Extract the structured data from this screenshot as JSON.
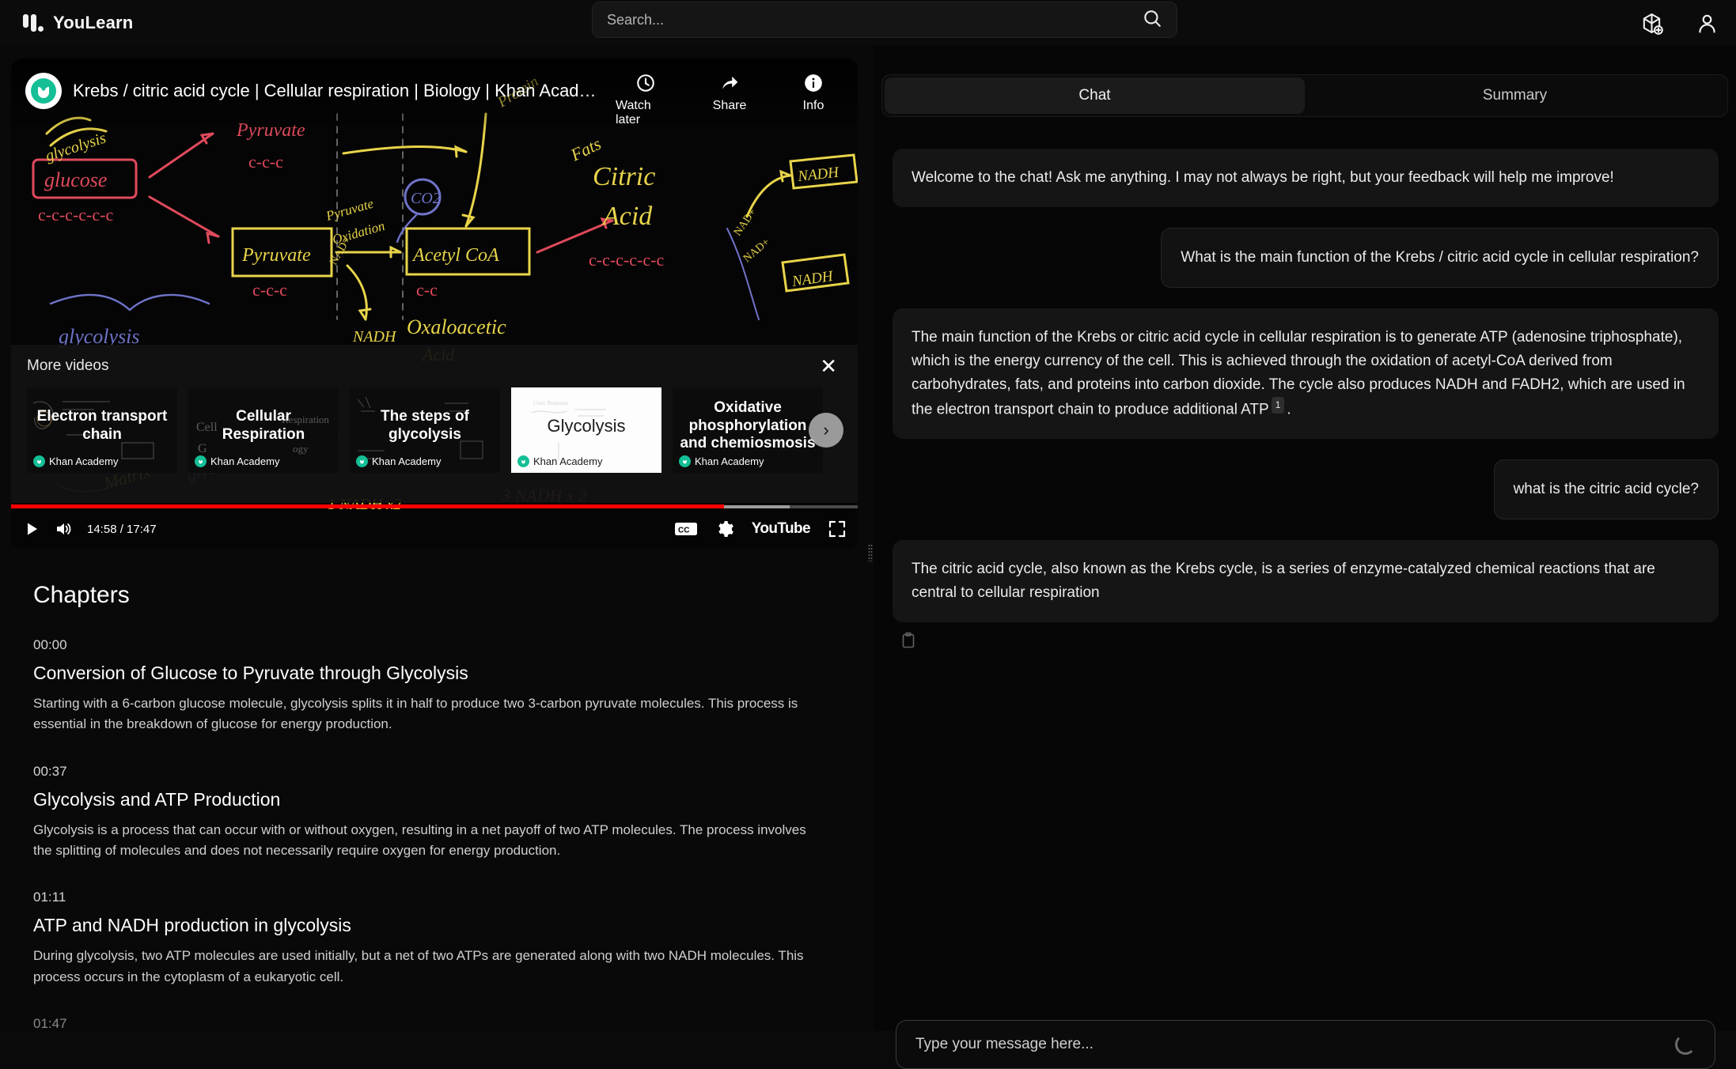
{
  "app": {
    "brand": "YouLearn",
    "logo_icon": "youlearn-logo-icon"
  },
  "header": {
    "search_placeholder": "Search...",
    "search_value": "",
    "search_icon": "search-icon",
    "add_content_icon": "cube-plus-icon",
    "profile_icon": "user-avatar-icon"
  },
  "video": {
    "title": "Krebs / citric acid cycle | Cellular respiration | Biology | Khan Acade...",
    "channel_avatar_icon": "khan-academy-logo-icon",
    "top_actions": [
      {
        "label": "Watch later",
        "icon": "clock-icon"
      },
      {
        "label": "Share",
        "icon": "share-arrow-icon"
      },
      {
        "label": "Info",
        "icon": "info-circle-icon"
      }
    ],
    "current_time": "14:58",
    "duration": "17:47",
    "time_display": "14:58 / 17:47",
    "progress_percent": 84.2,
    "buffered_percent": 92,
    "play_icon": "play-icon",
    "volume_icon": "volume-icon",
    "captions_icon": "closed-captions-icon",
    "settings_icon": "gear-icon",
    "youtube_logo": "YouTube",
    "fullscreen_icon": "fullscreen-icon",
    "progress_color": "#ff0000"
  },
  "more_videos": {
    "title": "More videos",
    "close_icon": "close-icon",
    "next_icon": "chevron-right-icon",
    "cards": [
      {
        "title": "Electron transport chain",
        "channel": "Khan Academy",
        "theme": "dark"
      },
      {
        "title": "Cellular Respiration",
        "channel": "Khan Academy",
        "theme": "dark"
      },
      {
        "title": "The steps of glycolysis",
        "channel": "Khan Academy",
        "theme": "dark"
      },
      {
        "title": "Glycolysis",
        "channel": "Khan Academy",
        "theme": "light"
      },
      {
        "title": "Oxidative phosphorylation and chemiosmosis",
        "channel": "Khan Academy",
        "theme": "dark"
      }
    ]
  },
  "chapters": {
    "heading": "Chapters",
    "items": [
      {
        "time": "00:00",
        "name": "Conversion of Glucose to Pyruvate through Glycolysis",
        "desc": "Starting with a 6-carbon glucose molecule, glycolysis splits it in half to produce two 3-carbon pyruvate molecules. This process is essential in the breakdown of glucose for energy production."
      },
      {
        "time": "00:37",
        "name": "Glycolysis and ATP Production",
        "desc": "Glycolysis is a process that can occur with or without oxygen, resulting in a net payoff of two ATP molecules. The process involves the splitting of molecules and does not necessarily require oxygen for energy production."
      },
      {
        "time": "01:11",
        "name": "ATP and NADH production in glycolysis",
        "desc": "During glycolysis, two ATP molecules are used initially, but a net of two ATPs are generated along with two NADH molecules. This process occurs in the cytoplasm of a eukaryotic cell."
      }
    ],
    "next_time": "01:47"
  },
  "chat": {
    "tabs": [
      {
        "label": "Chat",
        "active": true
      },
      {
        "label": "Summary",
        "active": false
      }
    ],
    "messages": [
      {
        "role": "bot",
        "text": "Welcome to the chat! Ask me anything. I may not always be right, but your feedback will help me improve!"
      },
      {
        "role": "user",
        "text": "What is the main function of the Krebs / citric acid cycle in cellular respiration?"
      },
      {
        "role": "bot",
        "text_before_citation": "The main function of the Krebs or citric acid cycle in cellular respiration is to generate ATP (adenosine triphosphate), which is the energy currency of the cell. This is achieved through the oxidation of acetyl-CoA derived from carbohydrates, fats, and proteins into carbon dioxide. The cycle also produces NADH and FADH2, which are used in the electron transport chain to produce additional ATP",
        "citation": "1",
        "text_after_citation": "."
      },
      {
        "role": "user",
        "text": "what is the citric acid cycle?"
      },
      {
        "role": "bot",
        "text": "The citric acid cycle, also known as the Krebs cycle, is a series of enzyme-catalyzed chemical reactions that are central to cellular respiration",
        "copy_icon": "copy-clipboard-icon"
      }
    ],
    "composer_placeholder": "Type your message here...",
    "composer_value": "",
    "loading_icon": "loading-spinner-icon"
  }
}
